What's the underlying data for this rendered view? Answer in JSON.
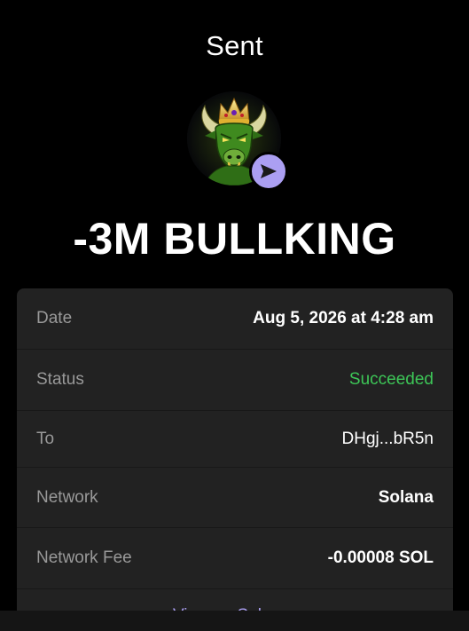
{
  "header": {
    "title": "Sent"
  },
  "token": {
    "avatar_icon": "bull-king-token-icon",
    "badge_icon": "send-arrow-icon",
    "amount_text": "-3M BULLKING"
  },
  "colors": {
    "background": "#000000",
    "card": "#222222",
    "accent": "#ab9ff2",
    "success": "#3dc657",
    "label": "#999999"
  },
  "details": {
    "date": {
      "label": "Date",
      "value": "Aug 5, 2026 at 4:28 am"
    },
    "status": {
      "label": "Status",
      "value": "Succeeded"
    },
    "to": {
      "label": "To",
      "value": "DHgj...bR5n"
    },
    "network": {
      "label": "Network",
      "value": "Solana"
    },
    "fee": {
      "label": "Network Fee",
      "value": "-0.00008 SOL"
    }
  },
  "footer": {
    "view_link": "View on Solscan"
  }
}
